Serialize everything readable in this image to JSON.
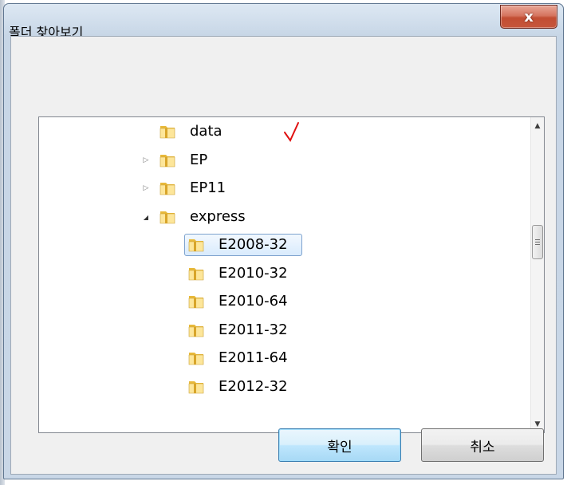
{
  "dialog": {
    "title": "폴더 찾아보기",
    "close_label": "x"
  },
  "tree": {
    "items": [
      {
        "label": "data",
        "expander": "",
        "level": 1
      },
      {
        "label": "EP",
        "expander": "collapsed",
        "level": 1
      },
      {
        "label": "EP11",
        "expander": "collapsed",
        "level": 1
      },
      {
        "label": "express",
        "expander": "expanded",
        "level": 1
      },
      {
        "label": "E2008-32",
        "expander": "",
        "level": 2,
        "selected": true
      },
      {
        "label": "E2010-32",
        "expander": "",
        "level": 2
      },
      {
        "label": "E2010-64",
        "expander": "",
        "level": 2
      },
      {
        "label": "E2011-32",
        "expander": "",
        "level": 2
      },
      {
        "label": "E2011-64",
        "expander": "",
        "level": 2
      },
      {
        "label": "E2012-32",
        "expander": "",
        "level": 2
      }
    ]
  },
  "buttons": {
    "ok": "확인",
    "cancel": "취소"
  },
  "icons": {
    "collapsed": "▷",
    "expanded": "◢",
    "scroll_up": "▲",
    "scroll_down": "▼"
  },
  "colors": {
    "folder_light": "#fde69a",
    "folder_dark": "#e8b93a",
    "selection_border": "#7da2ce",
    "check_mark": "#e01010"
  }
}
